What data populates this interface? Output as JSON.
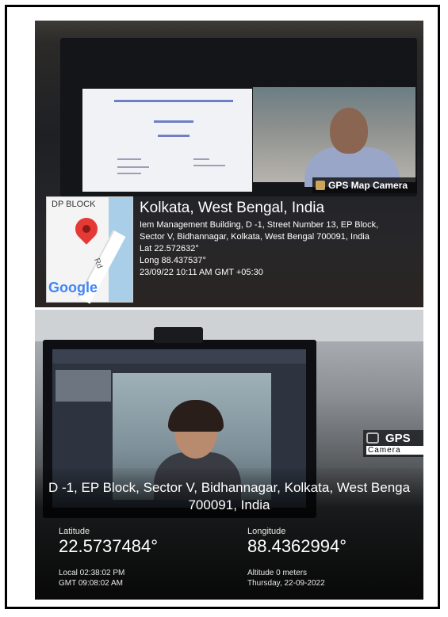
{
  "top_card": {
    "map_label": "DP BLOCK",
    "map_road_label": "Rd",
    "map_brand": "Google",
    "badge": "GPS Map Camera",
    "city": "Kolkata, West Bengal, India",
    "address_line1": "Iem Management Building, D -1, Street Number 13, EP Block,",
    "address_line2": "Sector V, Bidhannagar, Kolkata, West Bengal 700091, India",
    "lat": "Lat 22.572632°",
    "long": "Long 88.437537°",
    "datetime": "23/09/22 10:11 AM GMT +05:30"
  },
  "bottom_card": {
    "badge_title": "GPS",
    "badge_sub": "Camera",
    "address_line1": "D -1, EP Block, Sector V, Bidhannagar, Kolkata, West Benga",
    "address_line2": "700091, India",
    "latitude_label": "Latitude",
    "latitude_value": "22.5737484°",
    "longitude_label": "Longitude",
    "longitude_value": "88.4362994°",
    "local_time": "Local 02:38:02 PM",
    "gmt_time": "GMT 09:08:02 AM",
    "altitude": "Altitude 0 meters",
    "date": "Thursday, 22-09-2022"
  },
  "colors": {
    "pin": "#e53935",
    "google_blue": "#4285f4",
    "frame": "#000000"
  }
}
